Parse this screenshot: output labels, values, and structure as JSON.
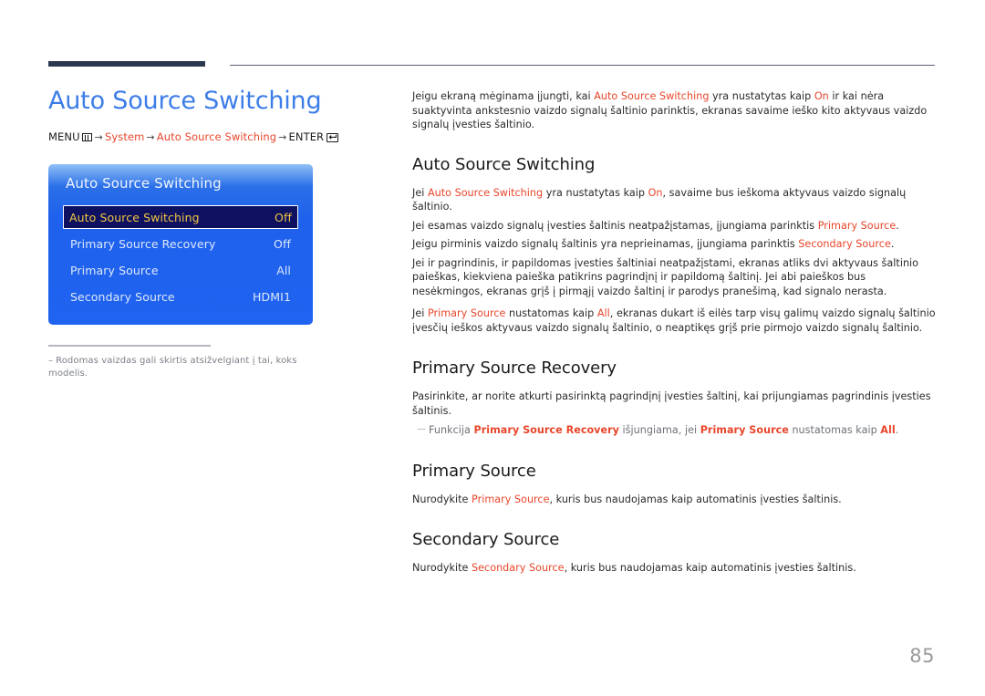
{
  "header": {
    "rule_color_thick": "#2b3850",
    "rule_color_thin": "#5c607a"
  },
  "left": {
    "page_title": "Auto Source Switching",
    "title_color": "#3d7de8",
    "breadcrumb": {
      "menu_label": "MENU",
      "menu_icon": "menu-grid-icon",
      "arrow": "→",
      "step1": "System",
      "step2": "Auto Source Switching",
      "enter_label": "ENTER",
      "enter_icon": "enter-key-icon"
    },
    "osd": {
      "title": "Auto Source Switching",
      "rows": [
        {
          "label": "Auto Source Switching",
          "value": "Off",
          "selected": true
        },
        {
          "label": "Primary Source Recovery",
          "value": "Off",
          "selected": false
        },
        {
          "label": "Primary Source",
          "value": "All",
          "selected": false
        },
        {
          "label": "Secondary Source",
          "value": "HDMI1",
          "selected": false
        }
      ],
      "selected_text_color": "#f2c643",
      "selected_bg_color": "#0d1160",
      "panel_color": "#1f61ec"
    },
    "note": {
      "dash": "–",
      "text": "Rodomas vaizdas gali skirtis atsižvelgiant į tai, koks modelis."
    }
  },
  "right": {
    "intro": {
      "p1_a": "Jeigu ekraną mėginama įjungti, kai ",
      "p1_hl1": "Auto Source Switching",
      "p1_b": " yra nustatytas kaip ",
      "p1_hl2": "On",
      "p1_c": " ir kai nėra suaktyvinta ankstesnio vaizdo signalų šaltinio parinktis, ekranas savaime ieško kito aktyvaus vaizdo signalų įvesties šaltinio."
    },
    "sections": [
      {
        "heading": "Auto Source Switching",
        "paragraphs": [
          {
            "a": "Jei ",
            "hl1": "Auto Source Switching",
            "b": " yra nustatytas kaip ",
            "hl2": "On",
            "c": ", savaime bus ieškoma aktyvaus vaizdo signalų šaltinio."
          },
          {
            "a": "Jei esamas vaizdo signalų įvesties šaltinis neatpažįstamas, įjungiama parinktis ",
            "hl1": "Primary Source",
            "b": "."
          },
          {
            "a": "Jeigu pirminis vaizdo signalų šaltinis yra neprieinamas, įjungiama parinktis ",
            "hl1": "Secondary Source",
            "b": "."
          },
          {
            "a": "Jei ir pagrindinis, ir papildomas įvesties šaltiniai neatpažįstami, ekranas atliks dvi aktyvaus šaltinio paieškas, kiekviena paieška patikrins pagrindįnį ir papildomą šaltinį. Jei abi paieškos bus nesėkmingos, ekranas grįš į pirmąjį vaizdo šaltinį ir parodys pranešimą, kad signalo nerasta."
          },
          {
            "a": "Jei ",
            "hl1": "Primary Source",
            "b": " nustatomas kaip ",
            "hl2": "All",
            "c": ", ekranas dukart iš eilės tarp visų galimų vaizdo signalų šaltinio įvesčių ieškos aktyvaus vaizdo signalų šaltinio, o neaptikęs grįš prie pirmojo vaizdo signalų šaltinio."
          }
        ]
      },
      {
        "heading": "Primary Source Recovery",
        "paragraphs": [
          {
            "a": "Pasirinkite, ar norite atkurti pasirinktą pagrindįnį įvesties šaltinį, kai prijungiamas pagrindinis įvesties šaltinis."
          }
        ],
        "note": {
          "dash": "—",
          "a": "Funkcija ",
          "hl1": "Primary Source Recovery",
          "b": " išjungiama, jei ",
          "hl2": "Primary Source",
          "c": " nustatomas kaip ",
          "hl3": "All",
          "d": "."
        }
      },
      {
        "heading": "Primary Source",
        "paragraphs": [
          {
            "a": "Nurodykite ",
            "hl1": "Primary Source",
            "b": ", kuris bus naudojamas kaip automatinis įvesties šaltinis."
          }
        ]
      },
      {
        "heading": "Secondary Source",
        "paragraphs": [
          {
            "a": "Nurodykite ",
            "hl1": "Secondary Source",
            "b": ", kuris bus naudojamas kaip automatinis įvesties šaltinis."
          }
        ]
      }
    ]
  },
  "footer": {
    "page_number": "85"
  },
  "colors": {
    "accent_red": "#e8462b",
    "heading_blue": "#3d7de8",
    "osd_blue": "#1f61ec",
    "osd_highlight": "#f2c643"
  }
}
